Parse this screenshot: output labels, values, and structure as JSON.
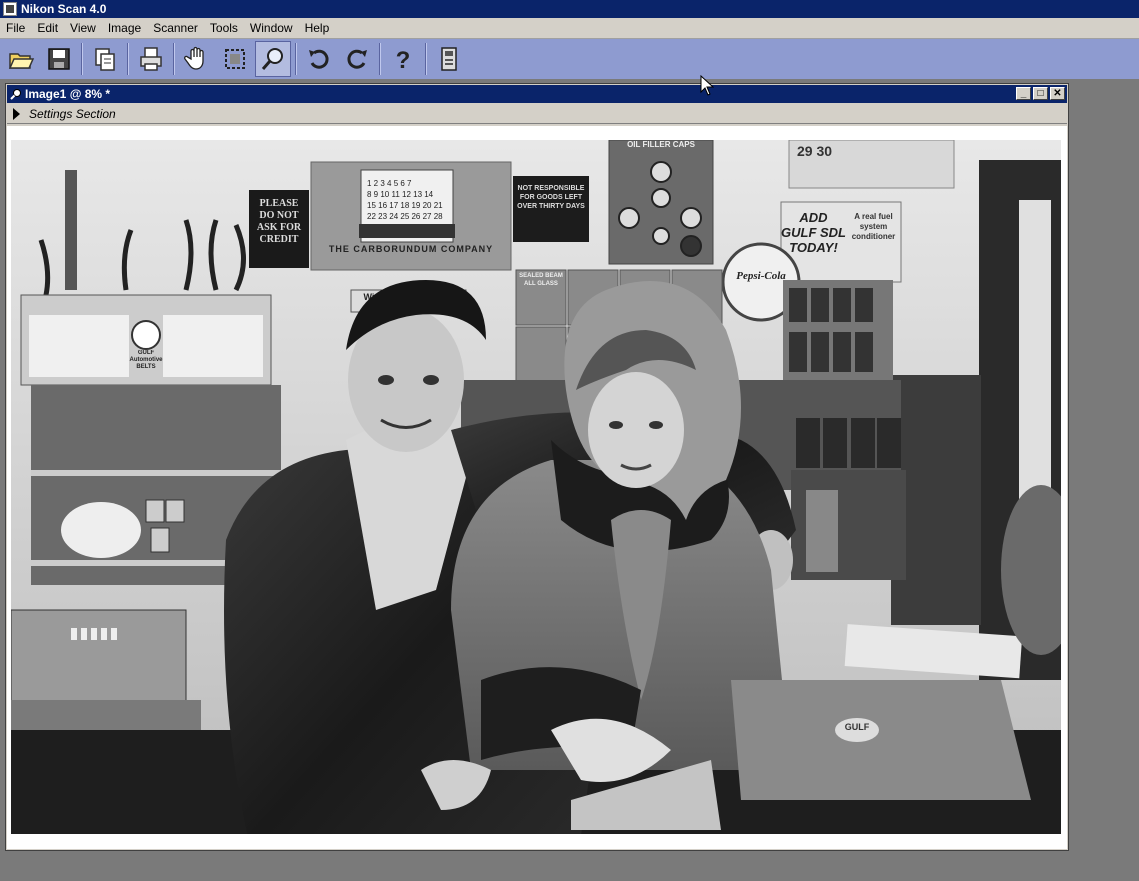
{
  "app": {
    "title": "Nikon Scan 4.0"
  },
  "menu": [
    "File",
    "Edit",
    "View",
    "Image",
    "Scanner",
    "Tools",
    "Window",
    "Help"
  ],
  "toolbar": {
    "buttons": [
      {
        "icon": "open-folder-icon"
      },
      {
        "icon": "save-icon"
      },
      {
        "icon": "copy-icon"
      },
      {
        "icon": "print-icon"
      },
      {
        "icon": "hand-icon"
      },
      {
        "icon": "crop-icon"
      },
      {
        "icon": "zoom-icon",
        "active": true
      },
      {
        "icon": "rotate-left-icon"
      },
      {
        "icon": "rotate-right-icon"
      },
      {
        "icon": "help-icon"
      },
      {
        "icon": "scanner-icon"
      }
    ]
  },
  "document": {
    "title": "Image1 @ 8% *",
    "controls": {
      "minimize": "_",
      "maximize": "□",
      "close": "✕"
    },
    "settings_label": "Settings Section"
  },
  "photo": {
    "signs": {
      "credit": "PLEASE DO NOT ASK FOR CREDIT",
      "carborundum": "THE CARBORUNDUM COMPANY",
      "notice": "NOT RESPONSIBLE FOR GOODS LEFT OVER THIRTY DAYS",
      "oil": "OIL FILLER CAPS",
      "wiper": "Wiper Arms & Blades",
      "gulf_sdl": "ADD GULF SDL TODAY!",
      "fuel": "A real fuel system conditioner",
      "pepsi": "Pepsi-Cola",
      "gulf_belts": "GULF Automotive BELTS",
      "sealed_beam": "SEALED BEAM",
      "all_glass": "ALL GLASS",
      "gulf_cap": "GULF"
    }
  }
}
